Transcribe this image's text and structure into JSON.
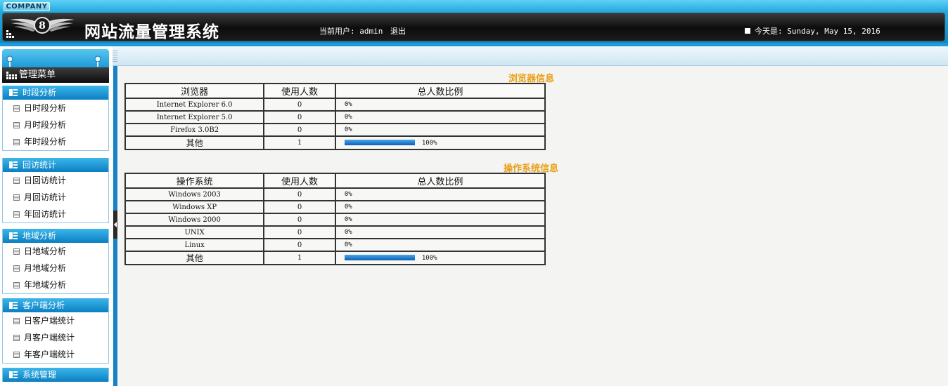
{
  "header": {
    "company": "COMPANY",
    "app_title": "网站流量管理系统",
    "current_user_label": "当前用户:",
    "current_user": "admin",
    "logout": "退出",
    "date_label": "今天是:",
    "date_value": "Sunday, May 15, 2016"
  },
  "sidebar": {
    "menu_title": "管理菜单",
    "sections": [
      {
        "title": "时段分析",
        "items": [
          "日时段分析",
          "月时段分析",
          "年时段分析"
        ]
      },
      {
        "title": "回访统计",
        "items": [
          "日回访统计",
          "月回访统计",
          "年回访统计"
        ]
      },
      {
        "title": "地域分析",
        "items": [
          "日地域分析",
          "月地域分析",
          "年地域分析"
        ]
      },
      {
        "title": "客户端分析",
        "items": [
          "日客户端统计",
          "月客户端统计",
          "年客户端统计"
        ]
      },
      {
        "title": "系统管理",
        "items": []
      }
    ]
  },
  "browser_table": {
    "caption": "浏览器信息",
    "headers": [
      "浏览器",
      "使用人数",
      "总人数比例"
    ],
    "rows": [
      {
        "name": "Internet Explorer 6.0",
        "count": "0",
        "ratio": 0,
        "ratio_label": "0%"
      },
      {
        "name": "Internet Explorer 5.0",
        "count": "0",
        "ratio": 0,
        "ratio_label": "0%"
      },
      {
        "name": "Firefox 3.0B2",
        "count": "0",
        "ratio": 0,
        "ratio_label": "0%"
      },
      {
        "name": "其他",
        "count": "1",
        "ratio": 100,
        "ratio_label": "100%"
      }
    ]
  },
  "os_table": {
    "caption": "操作系统信息",
    "headers": [
      "操作系统",
      "使用人数",
      "总人数比例"
    ],
    "rows": [
      {
        "name": "Windows 2003",
        "count": "0",
        "ratio": 0,
        "ratio_label": "0%"
      },
      {
        "name": "Windows XP",
        "count": "0",
        "ratio": 0,
        "ratio_label": "0%"
      },
      {
        "name": "Windows 2000",
        "count": "0",
        "ratio": 0,
        "ratio_label": "0%"
      },
      {
        "name": "UNIX",
        "count": "0",
        "ratio": 0,
        "ratio_label": "0%"
      },
      {
        "name": "Linux",
        "count": "0",
        "ratio": 0,
        "ratio_label": "0%"
      },
      {
        "name": "其他",
        "count": "1",
        "ratio": 100,
        "ratio_label": "100%"
      }
    ]
  }
}
